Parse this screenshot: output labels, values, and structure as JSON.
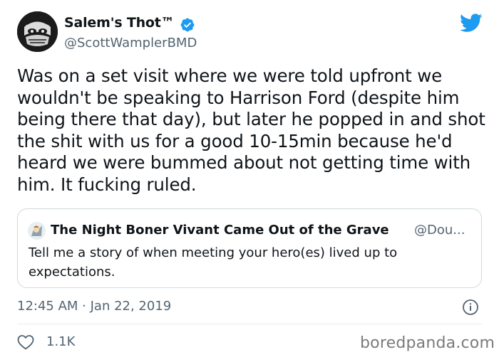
{
  "author": {
    "name": "Salem's Thot™",
    "handle": "@ScottWamplerBMD"
  },
  "tweet": {
    "text": "Was on a set visit where we were told upfront we wouldn't be speaking to Harrison Ford (despite him being there that day), but later he popped in and shot the shit with us for a good 10-15min because he'd heard we were bummed about not getting time with him. It fucking ruled.",
    "timestamp": "12:45 AM · Jan 22, 2019",
    "like_count": "1.1K"
  },
  "quote": {
    "name": "The Night Boner Vivant Came Out of the Grave",
    "handle": "@Dou...",
    "text": "Tell me a story of when meeting your hero(es) lived up to expectations."
  },
  "watermark": "boredpanda.com",
  "icons": {
    "verified": "verified-badge-icon",
    "brand": "twitter-bird-icon",
    "info": "info-icon",
    "like": "heart-icon"
  },
  "colors": {
    "brand_blue": "#1d9bf0",
    "text_primary": "#0f1419",
    "text_secondary": "#536471",
    "border": "#cfd9de"
  }
}
